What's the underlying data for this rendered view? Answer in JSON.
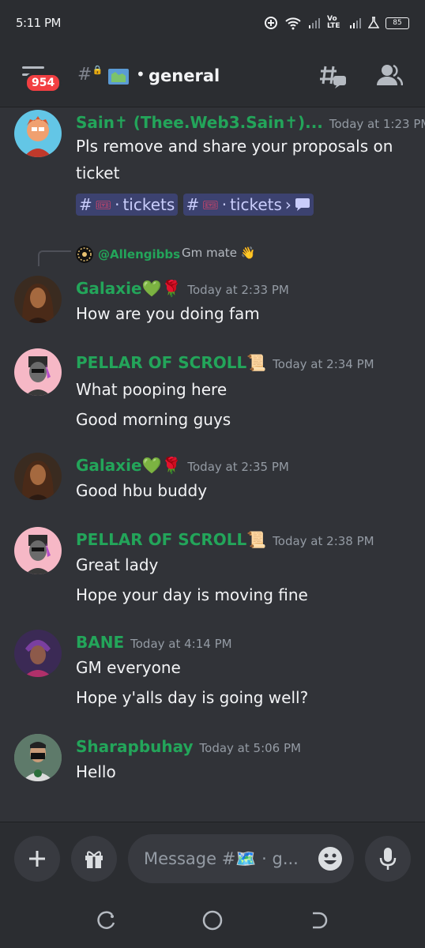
{
  "status_bar": {
    "time": "5:11 PM",
    "network": "Vo LTE",
    "battery": "85"
  },
  "header": {
    "unread_badge": "954",
    "channel_name": "general"
  },
  "messages": [
    {
      "author": "Sain✝ (Thee.Web3.Sain✝)...",
      "timestamp": "Today at 1:23 PM",
      "lines": [
        "Pls remove and share your proposals on",
        "ticket"
      ],
      "channel_links": [
        "tickets",
        "tickets"
      ]
    },
    {
      "reply_to": {
        "author": "@Allengibbs",
        "text": "Gm mate 👋"
      },
      "author": "Galaxie💚🌹",
      "timestamp": "Today at 2:33 PM",
      "lines": [
        "How are you doing fam"
      ]
    },
    {
      "author": "PELLAR OF SCROLL📜",
      "timestamp": "Today at 2:34 PM",
      "lines": [
        "What pooping here",
        "Good morning guys"
      ]
    },
    {
      "author": "Galaxie💚🌹",
      "timestamp": "Today at 2:35 PM",
      "lines": [
        "Good hbu buddy"
      ]
    },
    {
      "author": "PELLAR OF SCROLL📜",
      "timestamp": "Today at 2:38 PM",
      "lines": [
        "Great lady",
        "Hope your  day is moving fine"
      ]
    },
    {
      "author": "BANE",
      "timestamp": "Today at 4:14 PM",
      "lines": [
        "GM everyone",
        "Hope y'alls day is going well?"
      ]
    },
    {
      "author": "Sharapbuhay",
      "timestamp": "Today at 5:06 PM",
      "lines": [
        "Hello"
      ]
    }
  ],
  "composer": {
    "placeholder": "Message #🗺️ · g..."
  },
  "colors": {
    "background": "#313338",
    "username": "#23a55a",
    "badge": "#f23f42",
    "channel_link_bg": "#3c4270"
  },
  "icons": [
    "hamburger-icon",
    "lock-hash-icon",
    "map-flag-icon",
    "threads-icon",
    "members-icon",
    "plus-icon",
    "gift-icon",
    "emoji-icon",
    "microphone-icon",
    "recents-icon",
    "home-icon",
    "back-icon"
  ]
}
